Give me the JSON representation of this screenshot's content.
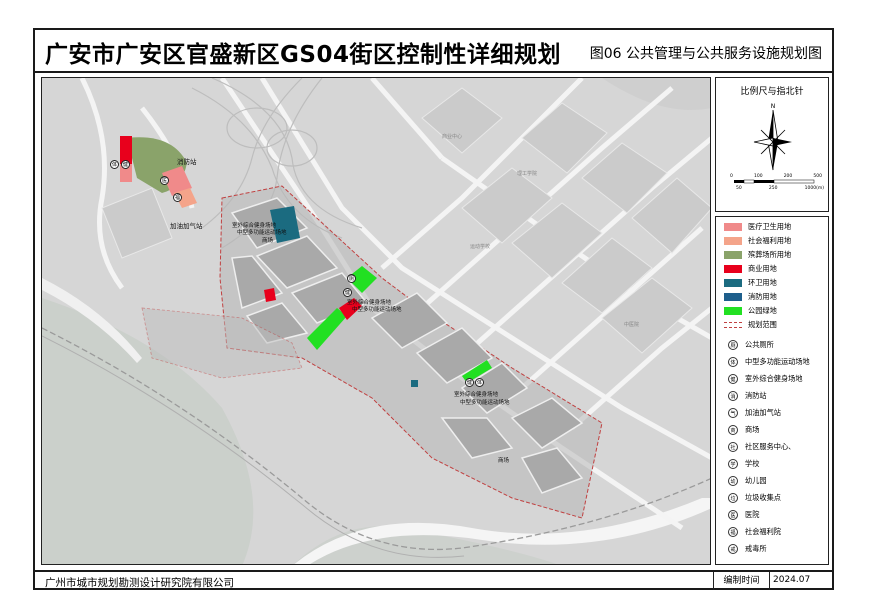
{
  "title": {
    "main": "广安市广安区官盛新区GS04街区控制性详细规划",
    "sheet": "图06  公共管理与公共服务设施规划图"
  },
  "compass": {
    "title": "比例尺与指北针",
    "ticks": [
      "0",
      "100",
      "200",
      "500"
    ],
    "ticks_lower": [
      "50",
      "250",
      "1000(m)"
    ]
  },
  "legend": [
    {
      "label": "医疗卫生用地",
      "color": "#f08a8a"
    },
    {
      "label": "社会福利用地",
      "color": "#f4a48a"
    },
    {
      "label": "殡葬场所用地",
      "color": "#8aa36a"
    },
    {
      "label": "商业用地",
      "color": "#e8001c"
    },
    {
      "label": "环卫用地",
      "color": "#1b6b80"
    },
    {
      "label": "消防用地",
      "color": "#1e5f8c"
    },
    {
      "label": "公园绿地",
      "color": "#22e022"
    },
    {
      "label": "规划范围",
      "color": "#c04040"
    }
  ],
  "symbols": [
    {
      "label": "公共厕所",
      "glyph": "厕"
    },
    {
      "label": "中型多功能运动场地",
      "glyph": "体"
    },
    {
      "label": "室外综合健身场地",
      "glyph": "健"
    },
    {
      "label": "消防站",
      "glyph": "消"
    },
    {
      "label": "加油加气站",
      "glyph": "气"
    },
    {
      "label": "商场",
      "glyph": "商"
    },
    {
      "label": "社区服务中心、",
      "glyph": "社"
    },
    {
      "label": "学校",
      "glyph": "学"
    },
    {
      "label": "幼儿园",
      "glyph": "幼"
    },
    {
      "label": "垃圾收集点",
      "glyph": "垃"
    },
    {
      "label": "医院",
      "glyph": "医"
    },
    {
      "label": "社会福利院",
      "glyph": "福"
    },
    {
      "label": "戒毒所",
      "glyph": "戒"
    }
  ],
  "map_labels": {
    "fire_station": "消防站",
    "gas_station": "加油加气站",
    "block1_a": "室外综合健身场地",
    "block1_b": "中型多功能运动场地",
    "block1_c": "商场",
    "block2_a": "室外综合健身场地",
    "block2_b": "中型多功能运动场地",
    "block3_a": "室外综合健身场地",
    "block3_b": "中型多功能运动场地",
    "mall": "商场",
    "ghost1": "商业中心",
    "ghost2": "理工学院",
    "ghost3": "运动学校",
    "ghost4": "中医院"
  },
  "footer": {
    "org": "广州市城市规划勘测设计研究院有限公司",
    "date_label": "编制时间",
    "date": "2024.07"
  }
}
